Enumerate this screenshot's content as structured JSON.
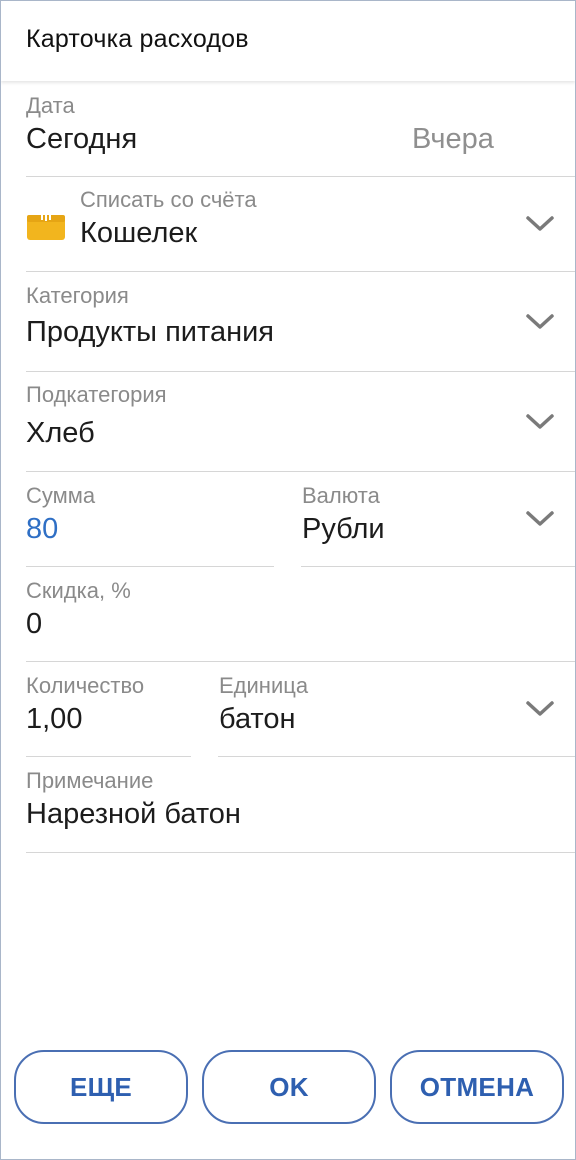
{
  "header": {
    "title": "Карточка расходов"
  },
  "date": {
    "label": "Дата",
    "today": "Сегодня",
    "yesterday": "Вчера"
  },
  "account": {
    "label": "Списать со счёта",
    "value": "Кошелек",
    "icon": "wallet-icon",
    "icon_color": "#f2b51e"
  },
  "category": {
    "label": "Категория",
    "value": "Продукты питания"
  },
  "subcategory": {
    "label": "Подкатегория",
    "value": "Хлеб"
  },
  "amount": {
    "label": "Сумма",
    "value": "80",
    "value_color": "#2f6fc5"
  },
  "currency": {
    "label": "Валюта",
    "value": "Рубли"
  },
  "discount": {
    "label": "Скидка, %",
    "value": "0"
  },
  "quantity": {
    "label": "Количество",
    "value": "1,00"
  },
  "unit": {
    "label": "Единица",
    "value": "батон"
  },
  "note": {
    "label": "Примечание",
    "value": "Нарезной батон"
  },
  "buttons": {
    "more": "ЕЩЕ",
    "ok": "OK",
    "cancel": "ОТМЕНА"
  },
  "colors": {
    "accent": "#2e5fb0",
    "border": "#4a6fb3",
    "divider": "#d6d6d6"
  }
}
